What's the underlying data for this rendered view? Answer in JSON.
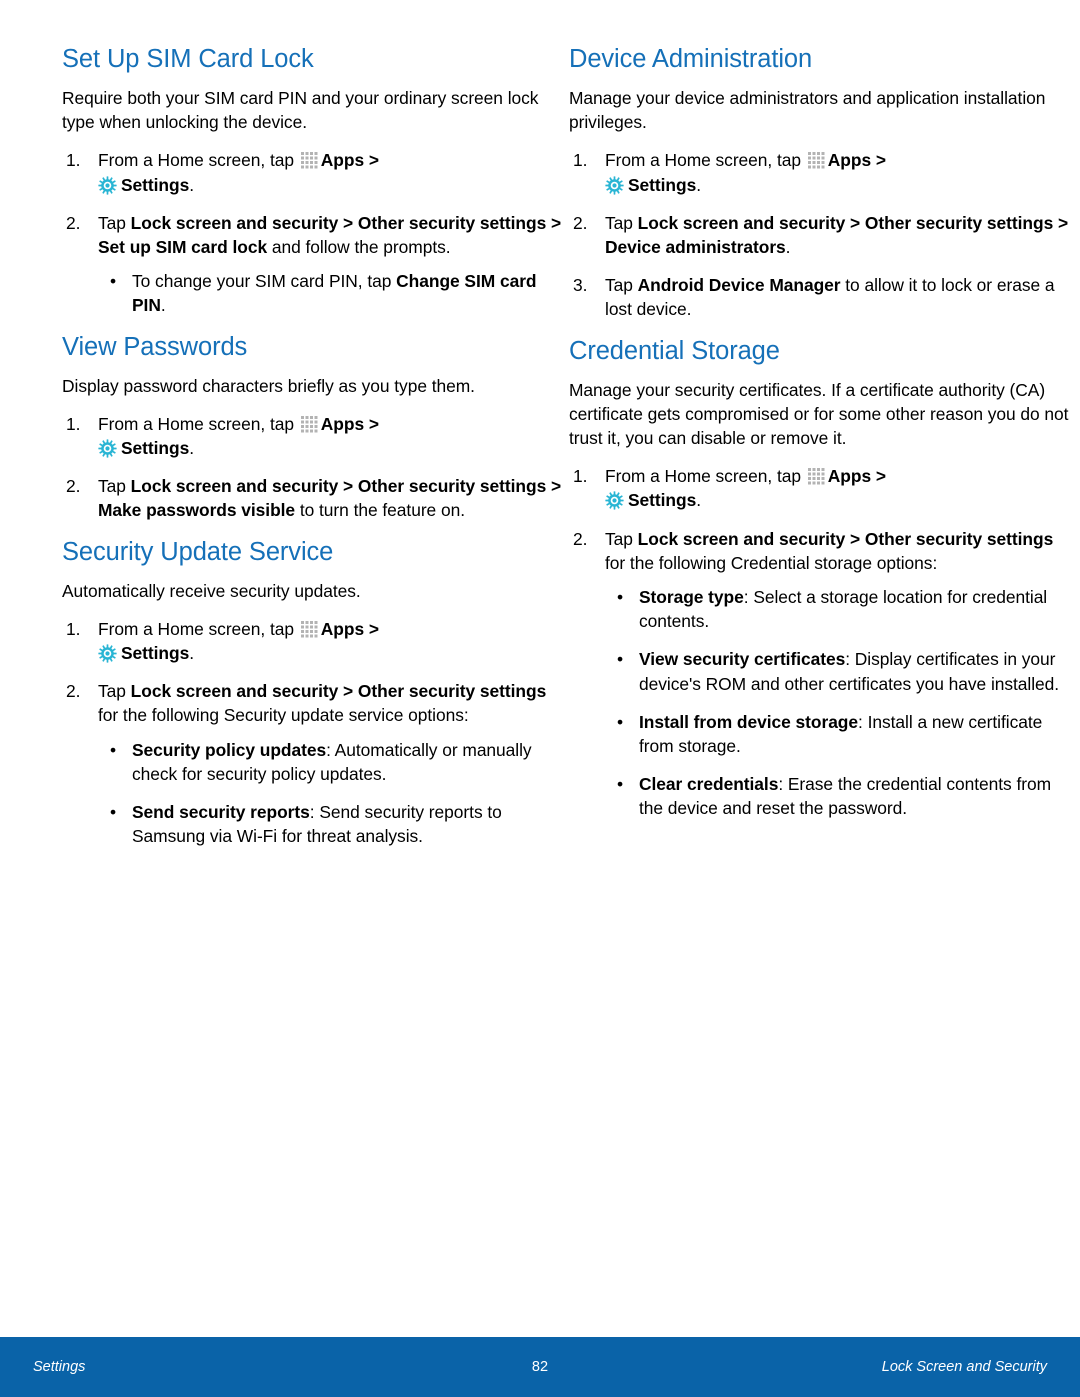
{
  "document": {
    "footer": {
      "left_label": "Settings",
      "page_number": "82",
      "right_label": "Lock Screen and Security",
      "bar_color": "#0a63a8"
    },
    "heading_color": "#1570b8",
    "icons": {
      "apps": "apps-grid-icon",
      "settings": "gear-icon",
      "settings_color": "#29b5d4"
    }
  },
  "left_column": {
    "sections": [
      {
        "title": "Set Up SIM Card Lock",
        "intro": "Require both your SIM card PIN and your ordinary screen lock type when unlocking the device.",
        "steps": [
          {
            "number": "1.",
            "lead": "From a Home screen, tap",
            "apps_label": "Apps",
            "separator": ">",
            "settings_label": "Settings",
            "trailing": "."
          },
          {
            "number": "2.",
            "text_runs": [
              {
                "text": "Tap ",
                "bold": false
              },
              {
                "text": "Lock screen and security > Other security settings > Set up SIM card lock",
                "bold": true
              },
              {
                "text": " and follow the prompts.",
                "bold": false
              }
            ],
            "bullets": [
              {
                "text_runs": [
                  {
                    "text": "To change your SIM card PIN, tap ",
                    "bold": false
                  },
                  {
                    "text": "Change SIM card PIN",
                    "bold": true
                  },
                  {
                    "text": ".",
                    "bold": false
                  }
                ]
              }
            ]
          }
        ]
      },
      {
        "title": "View Passwords",
        "intro": "Display password characters briefly as you type them.",
        "steps": [
          {
            "number": "1.",
            "lead": "From a Home screen, tap",
            "apps_label": "Apps",
            "separator": ">",
            "settings_label": "Settings",
            "trailing": "."
          },
          {
            "number": "2.",
            "text_runs": [
              {
                "text": "Tap ",
                "bold": false
              },
              {
                "text": "Lock screen and security > Other security settings > Make passwords visible",
                "bold": true
              },
              {
                "text": " to turn the feature on.",
                "bold": false
              }
            ],
            "bullets": []
          }
        ]
      },
      {
        "title": "Security Update Service",
        "intro": "Automatically receive security updates.",
        "steps": [
          {
            "number": "1.",
            "lead": "From a Home screen, tap",
            "apps_label": "Apps",
            "separator": ">",
            "settings_label": "Settings",
            "trailing": "."
          },
          {
            "number": "2.",
            "text_runs": [
              {
                "text": "Tap ",
                "bold": false
              },
              {
                "text": "Lock screen and security > Other security settings",
                "bold": true
              },
              {
                "text": " for the following Security update service options:",
                "bold": false
              }
            ],
            "bullets": [
              {
                "text_runs": [
                  {
                    "text": "Security policy updates",
                    "bold": true
                  },
                  {
                    "text": ": Automatically or manually check for security policy updates.",
                    "bold": false
                  }
                ]
              },
              {
                "text_runs": [
                  {
                    "text": "Send security reports",
                    "bold": true
                  },
                  {
                    "text": ": Send security reports to Samsung via Wi-Fi for threat analysis.",
                    "bold": false
                  }
                ]
              }
            ]
          }
        ]
      }
    ]
  },
  "right_column": {
    "sections": [
      {
        "title": "Device Administration",
        "intro": "Manage your device administrators and application installation privileges.",
        "steps": [
          {
            "number": "1.",
            "lead": "From a Home screen, tap",
            "apps_label": "Apps",
            "separator": ">",
            "settings_label": "Settings",
            "trailing": "."
          },
          {
            "number": "2.",
            "text_runs": [
              {
                "text": "Tap ",
                "bold": false
              },
              {
                "text": "Lock screen and security > Other security settings > Device administrators",
                "bold": true
              },
              {
                "text": ".",
                "bold": false
              }
            ],
            "bullets": []
          },
          {
            "number": "3.",
            "text_runs": [
              {
                "text": "Tap ",
                "bold": false
              },
              {
                "text": "Android Device Manager",
                "bold": true
              },
              {
                "text": " to allow it to lock or erase a lost device.",
                "bold": false
              }
            ],
            "bullets": []
          }
        ]
      },
      {
        "title": "Credential Storage",
        "intro": "Manage your security certificates. If a certificate authority (CA) certificate gets compromised or for some other reason you do not trust it, you can disable or remove it.",
        "steps": [
          {
            "number": "1.",
            "lead": "From a Home screen, tap",
            "apps_label": "Apps",
            "separator": ">",
            "settings_label": "Settings",
            "trailing": "."
          },
          {
            "number": "2.",
            "text_runs": [
              {
                "text": "Tap ",
                "bold": false
              },
              {
                "text": "Lock screen and security > Other security settings",
                "bold": true
              },
              {
                "text": " for the following Credential storage options:",
                "bold": false
              }
            ],
            "bullets": [
              {
                "text_runs": [
                  {
                    "text": "Storage type",
                    "bold": true
                  },
                  {
                    "text": ": Select a storage location for credential contents.",
                    "bold": false
                  }
                ]
              },
              {
                "text_runs": [
                  {
                    "text": "View security certificates",
                    "bold": true
                  },
                  {
                    "text": ": Display certificates in your device's ROM and other certificates you have installed.",
                    "bold": false
                  }
                ]
              },
              {
                "text_runs": [
                  {
                    "text": "Install from device storage",
                    "bold": true
                  },
                  {
                    "text": ": Install a new certificate from storage.",
                    "bold": false
                  }
                ]
              },
              {
                "text_runs": [
                  {
                    "text": "Clear credentials",
                    "bold": true
                  },
                  {
                    "text": ": Erase the credential contents from the device and reset the password.",
                    "bold": false
                  }
                ]
              }
            ]
          }
        ]
      }
    ]
  }
}
